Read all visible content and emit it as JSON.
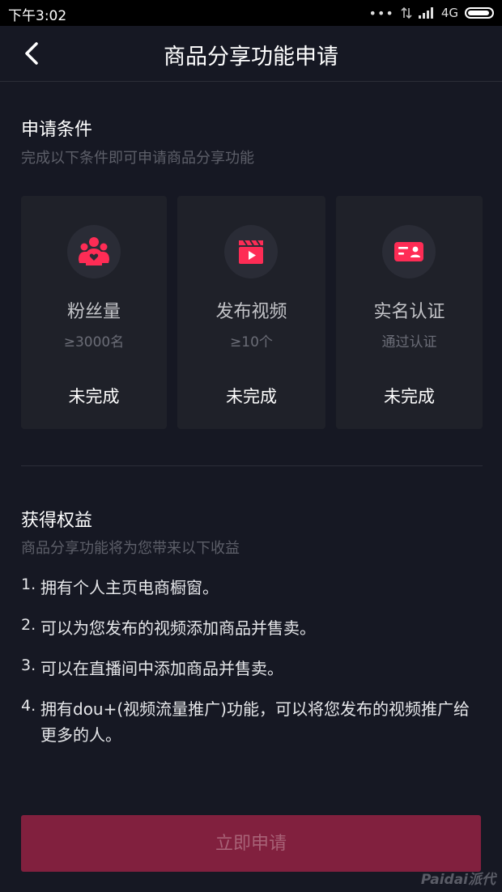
{
  "statusbar": {
    "time": "下午3:02",
    "dots": "•••",
    "network": "4G"
  },
  "header": {
    "title": "商品分享功能申请"
  },
  "conditions": {
    "title": "申请条件",
    "subtitle": "完成以下条件即可申请商品分享功能",
    "cards": [
      {
        "icon": "fans-icon",
        "name": "粉丝量",
        "requirement": "≥3000名",
        "status": "未完成"
      },
      {
        "icon": "video-icon",
        "name": "发布视频",
        "requirement": "≥10个",
        "status": "未完成"
      },
      {
        "icon": "id-card-icon",
        "name": "实名认证",
        "requirement": "通过认证",
        "status": "未完成"
      }
    ]
  },
  "benefits": {
    "title": "获得权益",
    "subtitle": "商品分享功能将为您带来以下收益",
    "items": [
      {
        "num": "1.",
        "text": "拥有个人主页电商橱窗。"
      },
      {
        "num": "2.",
        "text": "可以为您发布的视频添加商品并售卖。"
      },
      {
        "num": "3.",
        "text": "可以在直播间中添加商品并售卖。"
      },
      {
        "num": "4.",
        "text": "拥有dou+(视频流量推广)功能，可以将您发布的视频推广给更多的人。"
      }
    ]
  },
  "apply_button": {
    "label": "立即申请"
  },
  "watermark": {
    "text": "Paidai派代"
  },
  "colors": {
    "background": "#161823",
    "card": "#1f2129",
    "accent": "#fe2c55",
    "button": "#81203e"
  }
}
